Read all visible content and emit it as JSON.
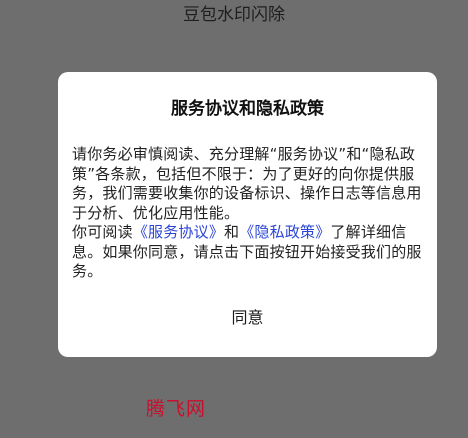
{
  "app": {
    "title": "豆包水印闪除"
  },
  "dialog": {
    "title": "服务协议和隐私政策",
    "paragraph1": "请你务必审慎阅读、充分理解“服务协议”和“隐私政策”各条款，包括但不限于：为了更好的向你提供服务，我们需要收集你的设备标识、操作日志等信息用于分析、优化应用性能。",
    "paragraph2_prefix": "你可阅读",
    "service_link": "《服务协议》",
    "and_text": "和",
    "privacy_link": "《隐私政策》",
    "paragraph2_suffix": "了解详细信息。如果你同意，请点击下面按钮开始接受我们的服务。",
    "agree_button": "同意"
  },
  "watermark": {
    "text": "腾飞网"
  },
  "colors": {
    "overlay_background": "#6e6e6e",
    "dialog_background": "#ffffff",
    "link": "#2b44d6",
    "watermark": "#c8102e"
  }
}
